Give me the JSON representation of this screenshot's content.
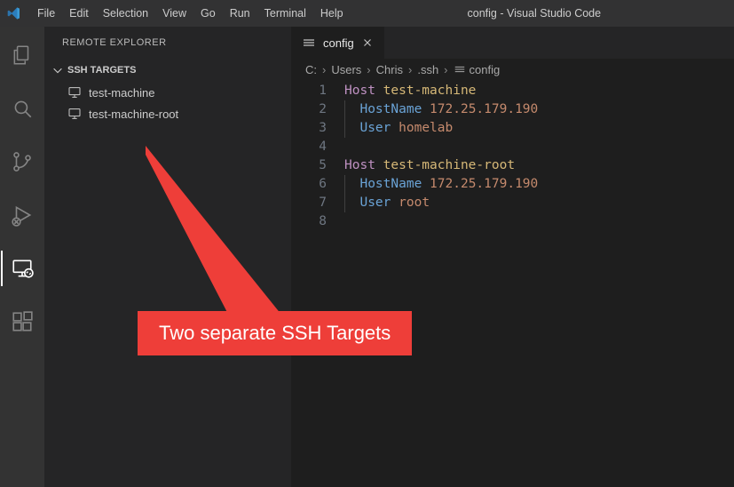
{
  "titlebar": {
    "title": "config - Visual Studio Code",
    "menu": [
      "File",
      "Edit",
      "Selection",
      "View",
      "Go",
      "Run",
      "Terminal",
      "Help"
    ]
  },
  "activity": {
    "items": [
      {
        "name": "explorer",
        "icon": "files"
      },
      {
        "name": "search",
        "icon": "search"
      },
      {
        "name": "scm",
        "icon": "branch"
      },
      {
        "name": "run",
        "icon": "debug"
      },
      {
        "name": "remote",
        "icon": "remote",
        "active": true
      },
      {
        "name": "extensions",
        "icon": "extensions"
      }
    ]
  },
  "sidebar": {
    "title": "REMOTE EXPLORER",
    "section": "SSH TARGETS",
    "targets": [
      {
        "label": "test-machine"
      },
      {
        "label": "test-machine-root"
      }
    ]
  },
  "tabs": {
    "open": [
      {
        "label": "config",
        "icon": "settings"
      }
    ]
  },
  "breadcrumbs": {
    "segments": [
      "C:",
      "Users",
      "Chris",
      ".ssh",
      "config"
    ]
  },
  "editor": {
    "line_count": 8,
    "lines": [
      {
        "n": 1,
        "indent": 0,
        "tokens": [
          [
            "kw",
            "Host"
          ],
          [
            "sp",
            " "
          ],
          [
            "hostname",
            "test-machine"
          ]
        ]
      },
      {
        "n": 2,
        "indent": 1,
        "tokens": [
          [
            "opt",
            "HostName"
          ],
          [
            "sp",
            " "
          ],
          [
            "str",
            "172.25.179.190"
          ]
        ]
      },
      {
        "n": 3,
        "indent": 1,
        "tokens": [
          [
            "opt",
            "User"
          ],
          [
            "sp",
            " "
          ],
          [
            "str",
            "homelab"
          ]
        ]
      },
      {
        "n": 4,
        "indent": 0,
        "tokens": []
      },
      {
        "n": 5,
        "indent": 0,
        "tokens": [
          [
            "kw",
            "Host"
          ],
          [
            "sp",
            " "
          ],
          [
            "hostname",
            "test-machine-root"
          ]
        ]
      },
      {
        "n": 6,
        "indent": 1,
        "tokens": [
          [
            "opt",
            "HostName"
          ],
          [
            "sp",
            " "
          ],
          [
            "str",
            "172.25.179.190"
          ]
        ]
      },
      {
        "n": 7,
        "indent": 1,
        "tokens": [
          [
            "opt",
            "User"
          ],
          [
            "sp",
            " "
          ],
          [
            "str",
            "root"
          ]
        ]
      },
      {
        "n": 8,
        "indent": 0,
        "tokens": []
      }
    ]
  },
  "annotation": {
    "text": "Two separate SSH Targets"
  },
  "colors": {
    "callout": "#ee3e39"
  }
}
